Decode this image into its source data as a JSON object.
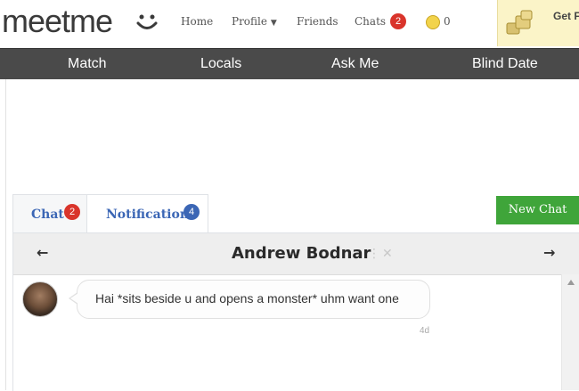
{
  "brand": {
    "logo_text": "meetme"
  },
  "header": {
    "nav": [
      {
        "label": "Home"
      },
      {
        "label": "Profile"
      },
      {
        "label": "Friends"
      },
      {
        "label": "Chats",
        "badge": "2"
      }
    ],
    "coins": "0",
    "credits_promo": "Get F Cred"
  },
  "main_nav": [
    "Match",
    "Locals",
    "Ask Me",
    "Blind Date"
  ],
  "tabs": [
    {
      "label": "Chat",
      "badge": "2"
    },
    {
      "label": "Notification",
      "badge": "4"
    }
  ],
  "new_chat_label": "New Chat",
  "chat": {
    "name": "Andrew Bodnar",
    "message": "Hai *sits beside u and opens a monster* uhm want one",
    "time": "4d"
  },
  "colors": {
    "nav_bg": "#4a4a4a",
    "badge_red": "#d9342b",
    "badge_blue": "#3b66b5",
    "new_chat_green": "#3fa53a",
    "credits_bg": "#fbf4c8"
  }
}
